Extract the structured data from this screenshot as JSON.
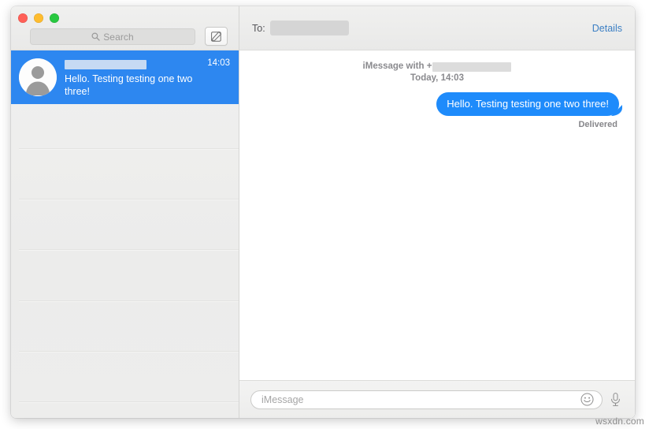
{
  "window": {
    "traffic_lights": [
      {
        "name": "close",
        "color": "#ff5f57"
      },
      {
        "name": "minimize",
        "color": "#febc2e"
      },
      {
        "name": "zoom",
        "color": "#28c840"
      }
    ]
  },
  "sidebar": {
    "search": {
      "placeholder": "Search",
      "icon": "search-icon"
    },
    "compose": {
      "icon": "compose-icon",
      "label": ""
    },
    "conversations": [
      {
        "name_redacted": true,
        "time": "14:03",
        "preview": "Hello. Testing testing one two three!",
        "selected": true,
        "avatar_icon": "person-avatar-icon"
      }
    ],
    "empty_row_count": 6
  },
  "conversation": {
    "header": {
      "to_label": "To:",
      "recipient_redacted": true,
      "details_label": "Details"
    },
    "thread": {
      "service_prefix": "iMessage with +",
      "phone_redacted": true,
      "date_line": "Today, 14:03",
      "messages": [
        {
          "text": "Hello. Testing testing one two three!",
          "outgoing": true,
          "status": "Delivered",
          "bubble_color": "#1e8bfb"
        }
      ]
    },
    "composer": {
      "placeholder": "iMessage",
      "emoji_icon": "smiley-icon",
      "mic_icon": "microphone-icon"
    }
  },
  "watermark": "wsxdn.com",
  "colors": {
    "accent_blue": "#2d87f0",
    "bubble_blue": "#1e8bfb",
    "link_blue": "#3b7fc4"
  }
}
